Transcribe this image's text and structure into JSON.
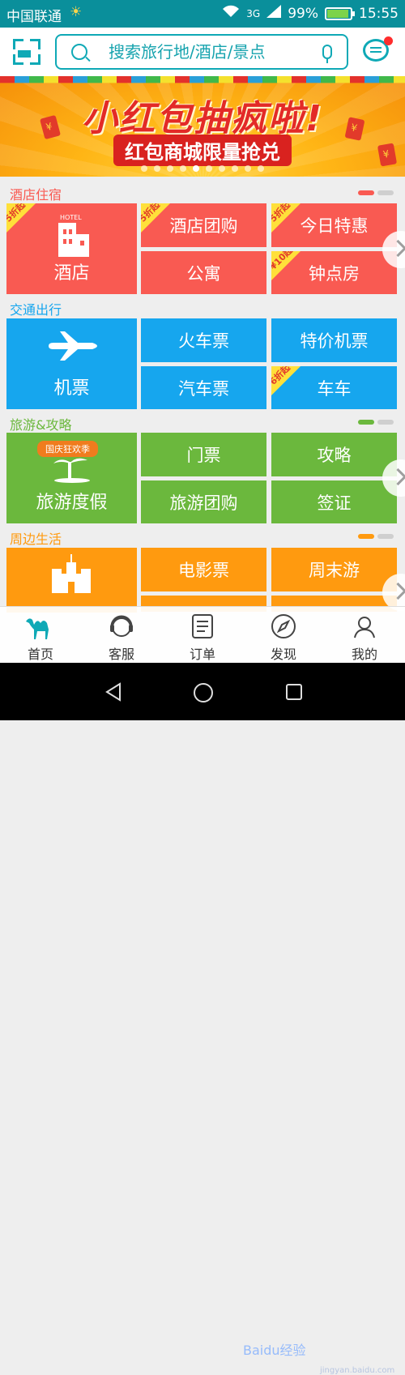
{
  "status_bar": {
    "carrier": "中国联通",
    "network": "3G",
    "battery_percent": "99%",
    "time": "15:55"
  },
  "header": {
    "search_placeholder": "搜索旅行地/酒店/景点"
  },
  "banner": {
    "title": "小红包抽疯啦!",
    "subtitle": "红包商城限量抢兑",
    "slide_count": 10,
    "active_slide": 5
  },
  "sections": [
    {
      "title": "酒店住宿",
      "accent": "#f95a52",
      "big": {
        "label": "酒店",
        "icon": "hotel-building-icon",
        "icon_text": "HOTEL",
        "badge": "5折起"
      },
      "tiles": [
        {
          "label": "酒店团购",
          "badge": "5折起"
        },
        {
          "label": "今日特惠",
          "badge": "5折起"
        },
        {
          "label": "公寓",
          "badge": ""
        },
        {
          "label": "钟点房",
          "badge": "¥10起"
        }
      ]
    },
    {
      "title": "交通出行",
      "accent": "#16a6ee",
      "big": {
        "label": "机票",
        "icon": "airplane-icon",
        "badge": ""
      },
      "tiles": [
        {
          "label": "火车票",
          "badge": ""
        },
        {
          "label": "特价机票",
          "badge": ""
        },
        {
          "label": "汽车票",
          "badge": ""
        },
        {
          "label": "车车",
          "badge": "6折起"
        }
      ]
    },
    {
      "title": "旅游&攻略",
      "accent": "#6bb83d",
      "big": {
        "label": "旅游度假",
        "icon": "palm-island-icon",
        "icon_text": "国庆狂欢季",
        "badge": ""
      },
      "tiles": [
        {
          "label": "门票",
          "badge": ""
        },
        {
          "label": "攻略",
          "badge": ""
        },
        {
          "label": "旅游团购",
          "badge": ""
        },
        {
          "label": "签证",
          "badge": ""
        }
      ]
    },
    {
      "title": "周边生活",
      "accent": "#ff9a0f",
      "big": {
        "label": "",
        "icon": "castle-icon",
        "badge": ""
      },
      "tiles": [
        {
          "label": "电影票",
          "badge": ""
        },
        {
          "label": "周末游",
          "badge": ""
        }
      ]
    }
  ],
  "bottom_nav": [
    {
      "label": "首页",
      "icon": "camel-icon",
      "active": true
    },
    {
      "label": "客服",
      "icon": "headset-icon",
      "active": false
    },
    {
      "label": "订单",
      "icon": "order-list-icon",
      "active": false
    },
    {
      "label": "发现",
      "icon": "compass-icon",
      "active": false
    },
    {
      "label": "我的",
      "icon": "profile-icon",
      "active": false
    }
  ],
  "watermark": {
    "text": "Baidu经验",
    "url": "jingyan.baidu.com"
  }
}
